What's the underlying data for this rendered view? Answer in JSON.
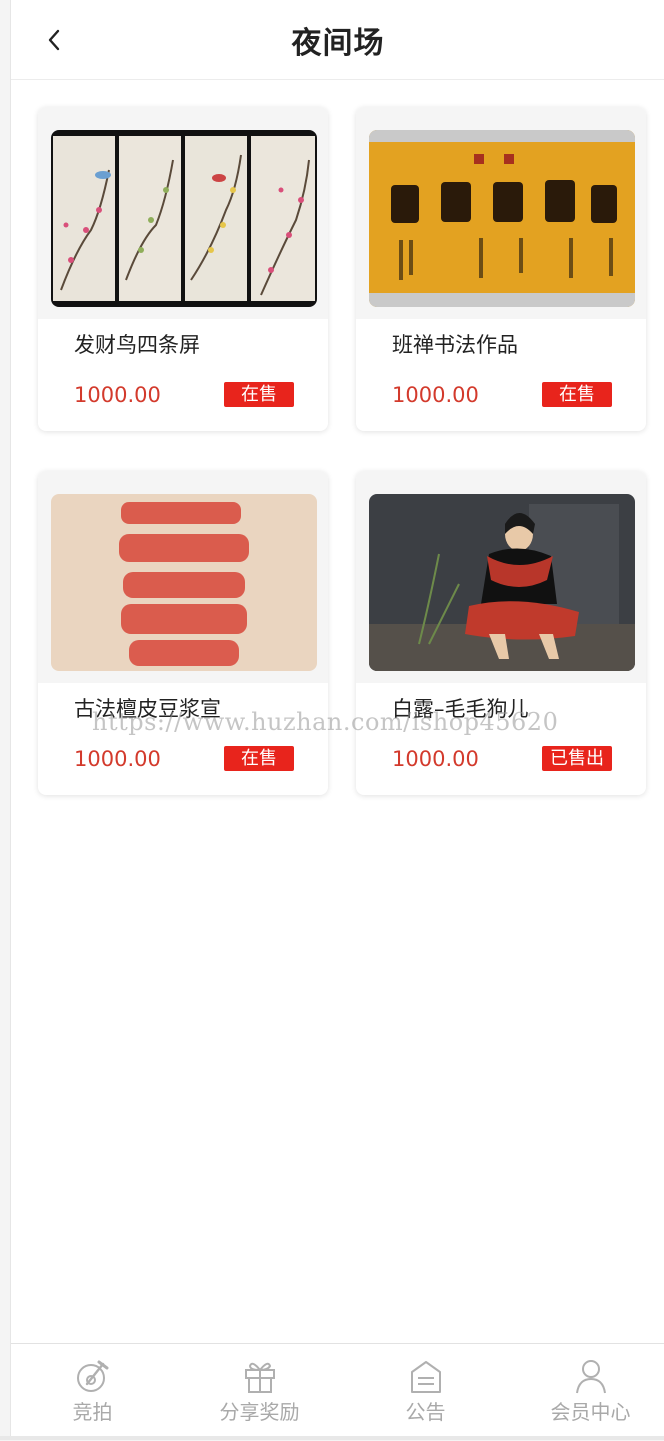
{
  "header": {
    "title": "夜间场",
    "back_icon": "chevron-left-icon"
  },
  "products": [
    {
      "name": "发财鸟四条屏",
      "price": "1000.00",
      "status": "在售",
      "image": "bird-plum-blossom-four-panel-painting"
    },
    {
      "name": "班禅书法作品",
      "price": "1000.00",
      "status": "在售",
      "image": "calligraphy-on-gold-paper"
    },
    {
      "name": "古法檀皮豆浆宣",
      "price": "1000.00",
      "status": "在售",
      "image": "red-calligraphy-xuan-paper"
    },
    {
      "name": "白露–毛毛狗儿",
      "price": "1000.00",
      "status": "已售出",
      "image": "portrait-of-woman-in-red-scarf"
    }
  ],
  "watermark": "https://www.huzhan.com/ishop45620",
  "tabbar": {
    "items": [
      {
        "label": "竞拍",
        "icon": "auction-icon"
      },
      {
        "label": "分享奖励",
        "icon": "gift-icon"
      },
      {
        "label": "公告",
        "icon": "announcement-icon"
      },
      {
        "label": "会员中心",
        "icon": "user-icon"
      }
    ]
  },
  "colors": {
    "price": "#d33a2c",
    "badge": "#e8241c",
    "tab_inactive": "#a9a9a9"
  }
}
